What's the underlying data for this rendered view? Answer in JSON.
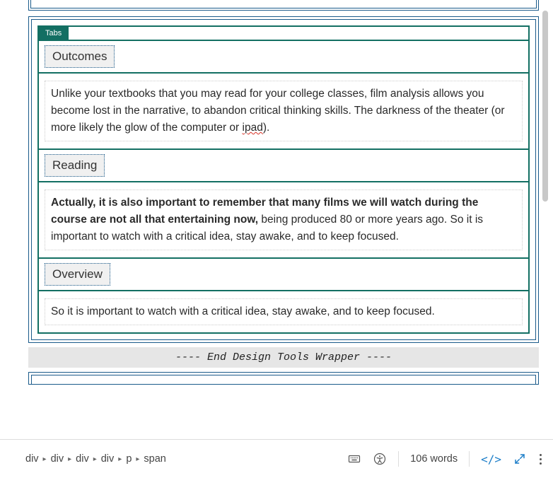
{
  "tabs": {
    "label": "Tabs",
    "items": [
      {
        "title": "Outcomes",
        "body_parts": [
          {
            "bold": false,
            "text": "Unlike your textbooks that you may read for your college classes, film analysis allows you become lost in the narrative, to abandon critical thinking skills. The darkness of the theater (or more likely the glow of the computer or "
          },
          {
            "bold": false,
            "spellerr": true,
            "text": "ipad"
          },
          {
            "bold": false,
            "text": ")."
          }
        ]
      },
      {
        "title": "Reading",
        "body_parts": [
          {
            "bold": true,
            "text": "Actually, it is also important to remember that many films we will watch during the course are not all that entertaining now,"
          },
          {
            "bold": false,
            "text": " being produced 80 or more years ago.  So it is important to watch with a critical idea, stay awake, and to keep focused."
          }
        ]
      },
      {
        "title": "Overview",
        "body_parts": [
          {
            "bold": false,
            "text": "So it is important to watch with a critical idea, stay awake, and to keep focused."
          }
        ]
      }
    ]
  },
  "end_wrapper": "---- End Design Tools Wrapper ----",
  "breadcrumb": [
    "div",
    "div",
    "div",
    "div",
    "p",
    "span"
  ],
  "word_count_label": "106 words",
  "code_icon_label": "</>"
}
